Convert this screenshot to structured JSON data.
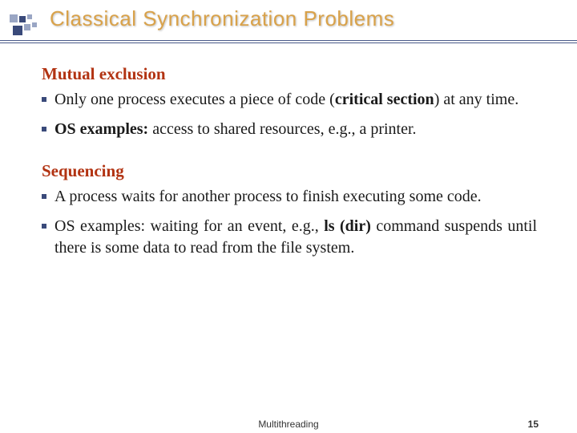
{
  "title": "Classical Synchronization Problems",
  "sections": [
    {
      "heading": "Mutual exclusion",
      "bullets": [
        {
          "html": "Only one process executes a piece of code (<b>critical section</b>) at any time."
        },
        {
          "html": "<b>OS examples:</b> access to shared resources, e.g., a printer."
        }
      ]
    },
    {
      "heading": "Sequencing",
      "bullets": [
        {
          "html": "A process waits for another process to finish executing some code."
        },
        {
          "html": "OS examples: waiting for an event, e.g., <b>ls (dir)</b> command suspends until there is some data to read from the file system."
        }
      ]
    }
  ],
  "footer": {
    "center": "Multithreading",
    "page": "15"
  }
}
